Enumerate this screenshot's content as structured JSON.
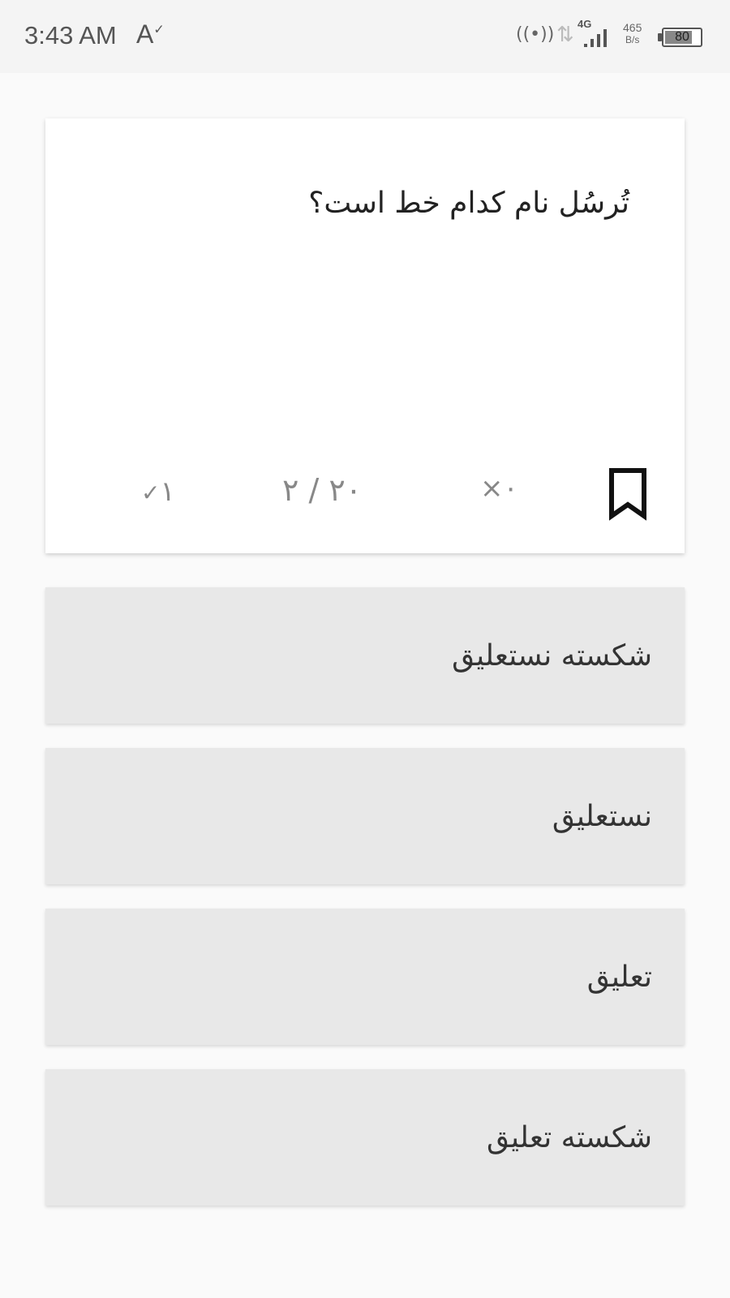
{
  "status_bar": {
    "time": "3:43 AM",
    "accessibility_letter": "A",
    "accessibility_mark": "✓",
    "hotspot_icon": "((•))",
    "data_arrows_icon": "⇅",
    "network_type": "4G",
    "speed_value": "465",
    "speed_unit": "B/s",
    "battery_level": "80",
    "battery_fraction": 0.8
  },
  "question": {
    "text": "تُرسُل نام کدام خط است؟",
    "correct_count": "۱",
    "correct_icon": "✓",
    "progress": "۲ / ۲۰",
    "wrong_count": "۰",
    "wrong_icon": "×",
    "bookmark_icon": "bookmark-icon"
  },
  "options": [
    {
      "label": "شکسته نستعلیق"
    },
    {
      "label": "نستعلیق"
    },
    {
      "label": "تعلیق"
    },
    {
      "label": "شکسته تعلیق"
    }
  ],
  "colors": {
    "card_bg": "#ffffff",
    "option_bg": "#e8e8e8",
    "stat_text": "#888888",
    "page_bg": "#fafafa"
  }
}
